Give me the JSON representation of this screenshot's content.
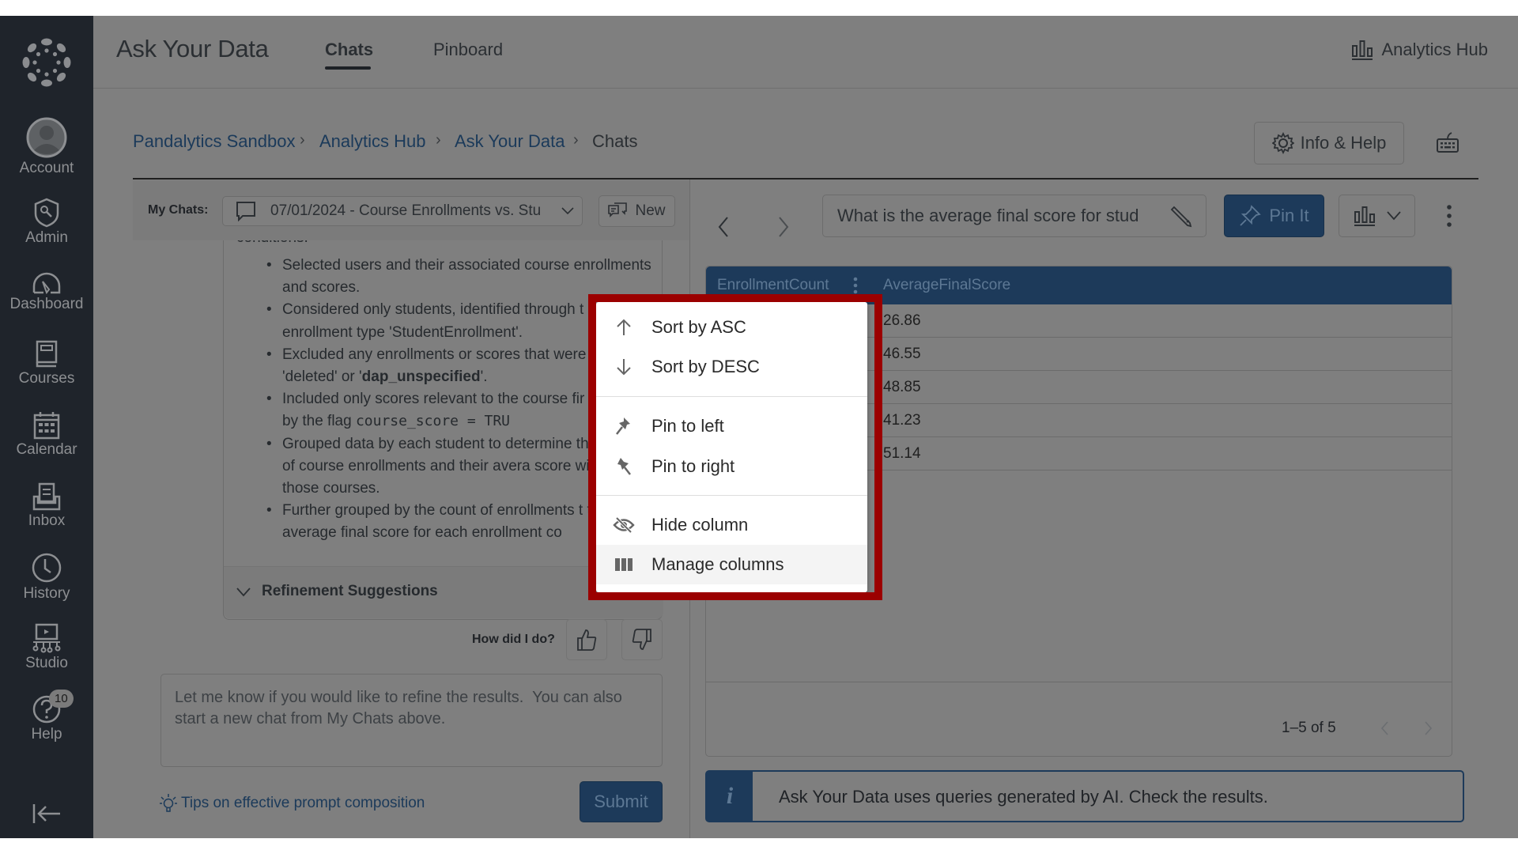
{
  "sidebar": {
    "items": [
      {
        "label": "Account",
        "icon": "account-icon"
      },
      {
        "label": "Admin",
        "icon": "admin-shield-icon"
      },
      {
        "label": "Dashboard",
        "icon": "dashboard-icon"
      },
      {
        "label": "Courses",
        "icon": "courses-icon"
      },
      {
        "label": "Calendar",
        "icon": "calendar-icon"
      },
      {
        "label": "Inbox",
        "icon": "inbox-icon"
      },
      {
        "label": "History",
        "icon": "history-icon"
      },
      {
        "label": "Studio",
        "icon": "studio-icon"
      },
      {
        "label": "Help",
        "icon": "help-icon",
        "badge": "10"
      }
    ],
    "collapse_icon": "collapse-arrow-icon"
  },
  "header": {
    "title": "Ask Your Data",
    "tabs": [
      {
        "label": "Chats",
        "active": true
      },
      {
        "label": "Pinboard",
        "active": false
      }
    ],
    "analytics_hub": "Analytics Hub"
  },
  "breadcrumb": {
    "items": [
      "Pandalytics Sandbox",
      "Analytics Hub",
      "Ask Your Data"
    ],
    "current": "Chats",
    "separator": "›"
  },
  "toolbar": {
    "info_help": "Info & Help"
  },
  "chats_bar": {
    "label": "My Chats:",
    "selected_chat": "07/01/2024 - Course Enrollments vs. Stu",
    "new_label": "New"
  },
  "answer": {
    "cut_line": "conditions:",
    "bullets": [
      {
        "text": "Selected users and their associated course enrollments and scores."
      },
      {
        "text": "Considered only students, identified through t enrollment type 'StudentEnrollment'."
      },
      {
        "pre": "Excluded any enrollments or scores that were as 'deleted' or '",
        "bold": "dap_unspecified",
        "post": "'."
      },
      {
        "pre": "Included only scores relevant to the course fir identified by the flag ",
        "code": "course_score = TRU",
        "post": ""
      },
      {
        "text": "Grouped data by each student to determine th number of course enrollments and their avera score within those courses."
      },
      {
        "text": "Further grouped by the count of enrollments t the average final score for each enrollment co"
      }
    ],
    "refinement_label": "Refinement Suggestions"
  },
  "feedback": {
    "label": "How did I do?"
  },
  "prompt": {
    "placeholder": "Let me know if you would like to refine the results.  You can also start a new chat from My Chats above.",
    "value": "",
    "tips_link": "Tips on effective prompt composition",
    "submit_label": "Submit"
  },
  "query_bar": {
    "question": "What is the average final score for stud",
    "pin_label": "Pin It"
  },
  "table": {
    "columns": [
      "EnrollmentCount",
      "AverageFinalScore"
    ],
    "rows": [
      {
        "EnrollmentCount": "",
        "AverageFinalScore": "26.86"
      },
      {
        "EnrollmentCount": "",
        "AverageFinalScore": "46.55"
      },
      {
        "EnrollmentCount": "",
        "AverageFinalScore": "48.85"
      },
      {
        "EnrollmentCount": "",
        "AverageFinalScore": "41.23"
      },
      {
        "EnrollmentCount": "",
        "AverageFinalScore": "51.14"
      }
    ],
    "pagination": "1–5 of 5"
  },
  "column_menu": {
    "items": [
      {
        "label": "Sort by ASC",
        "icon": "arrow-up-icon"
      },
      {
        "label": "Sort by DESC",
        "icon": "arrow-down-icon"
      },
      {
        "label": "Pin to left",
        "icon": "pin-left-icon"
      },
      {
        "label": "Pin to right",
        "icon": "pin-right-icon"
      },
      {
        "label": "Hide column",
        "icon": "eye-off-icon"
      },
      {
        "label": "Manage columns",
        "icon": "columns-icon",
        "highlighted": true
      }
    ],
    "highlight_color": "#9b0000"
  },
  "banner": {
    "text": "Ask Your Data uses queries generated by AI. Check the results."
  },
  "colors": {
    "brand_dark": "#1d3a5a",
    "sidebar_bg": "#1f242b",
    "overlay_bg": "#7f7f7f",
    "callout_red": "#9b0000"
  }
}
